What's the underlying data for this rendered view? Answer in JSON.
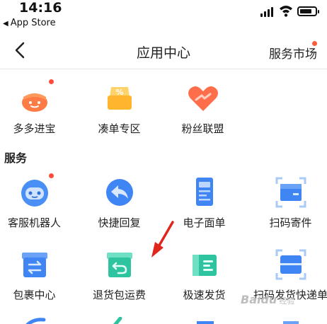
{
  "status_bar": {
    "time": "14:16",
    "back_app": "App Store"
  },
  "nav": {
    "title": "应用中心",
    "right_link": "服务市场"
  },
  "top_apps": [
    {
      "label": "多多进宝",
      "icon": "treasure-pot-icon",
      "badge": true
    },
    {
      "label": "凑单专区",
      "icon": "coupon-box-icon",
      "badge": false
    },
    {
      "label": "粉丝联盟",
      "icon": "heart-fans-icon",
      "badge": false
    }
  ],
  "services": {
    "title": "服务",
    "items": [
      {
        "label": "客服机器人",
        "icon": "robot-icon",
        "badge": true
      },
      {
        "label": "快捷回复",
        "icon": "quick-reply-icon",
        "badge": false
      },
      {
        "label": "电子面单",
        "icon": "e-waybill-icon",
        "badge": false
      },
      {
        "label": "扫码寄件",
        "icon": "scan-send-icon",
        "badge": false
      },
      {
        "label": "包裹中心",
        "icon": "package-center-icon",
        "badge": false
      },
      {
        "label": "退货包运费",
        "icon": "return-shipping-icon",
        "badge": false
      },
      {
        "label": "极速发货",
        "icon": "fast-ship-icon",
        "badge": false
      },
      {
        "label": "扫码发货快递单",
        "icon": "scan-ship-icon",
        "badge": false
      }
    ]
  },
  "watermark": {
    "brand": "Baidu",
    "sub": "经验"
  },
  "colors": {
    "orange": "#ff8a4a",
    "blue": "#3f86f4",
    "green": "#2ec4a0",
    "red_dot": "#ff4d3a"
  }
}
